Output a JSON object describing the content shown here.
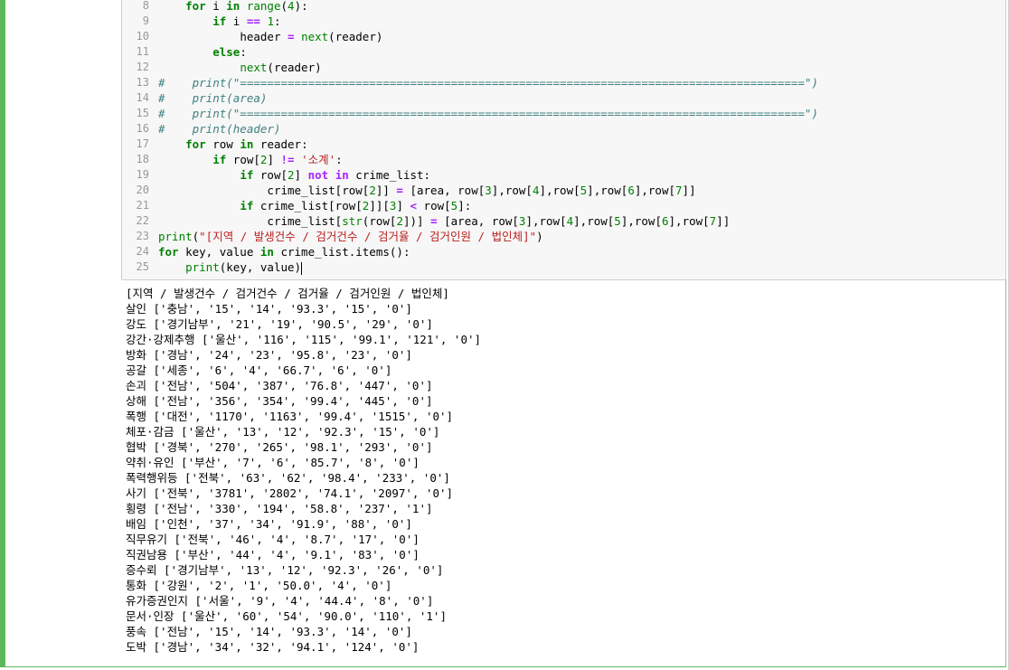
{
  "code_lines": [
    {
      "n": "8",
      "indent": "    ",
      "tokens": [
        [
          "kw",
          "for"
        ],
        [
          "t",
          " i "
        ],
        [
          "kw",
          "in"
        ],
        [
          "t",
          " "
        ],
        [
          "bi",
          "range"
        ],
        [
          "t",
          "("
        ],
        [
          "num",
          "4"
        ],
        [
          "t",
          "):"
        ]
      ]
    },
    {
      "n": "9",
      "indent": "        ",
      "tokens": [
        [
          "kw",
          "if"
        ],
        [
          "t",
          " i "
        ],
        [
          "op",
          "=="
        ],
        [
          "t",
          " "
        ],
        [
          "num",
          "1"
        ],
        [
          "t",
          ":"
        ]
      ]
    },
    {
      "n": "10",
      "indent": "            ",
      "tokens": [
        [
          "t",
          "header "
        ],
        [
          "op",
          "="
        ],
        [
          "t",
          " "
        ],
        [
          "bi",
          "next"
        ],
        [
          "t",
          "(reader)"
        ]
      ]
    },
    {
      "n": "11",
      "indent": "        ",
      "tokens": [
        [
          "kw",
          "else"
        ],
        [
          "t",
          ":"
        ]
      ]
    },
    {
      "n": "12",
      "indent": "            ",
      "tokens": [
        [
          "bi",
          "next"
        ],
        [
          "t",
          "(reader)"
        ]
      ]
    },
    {
      "n": "13",
      "indent": "",
      "tokens": [
        [
          "cm",
          "#    print(\"===================================================================================\")"
        ]
      ]
    },
    {
      "n": "14",
      "indent": "",
      "tokens": [
        [
          "cm",
          "#    print(area)"
        ]
      ]
    },
    {
      "n": "15",
      "indent": "",
      "tokens": [
        [
          "cm",
          "#    print(\"===================================================================================\")"
        ]
      ]
    },
    {
      "n": "16",
      "indent": "",
      "tokens": [
        [
          "cm",
          "#    print(header)"
        ]
      ]
    },
    {
      "n": "17",
      "indent": "    ",
      "tokens": [
        [
          "kw",
          "for"
        ],
        [
          "t",
          " row "
        ],
        [
          "kw",
          "in"
        ],
        [
          "t",
          " reader:"
        ]
      ]
    },
    {
      "n": "18",
      "indent": "        ",
      "tokens": [
        [
          "kw",
          "if"
        ],
        [
          "t",
          " row["
        ],
        [
          "num",
          "2"
        ],
        [
          "t",
          "] "
        ],
        [
          "op",
          "!="
        ],
        [
          "t",
          " "
        ],
        [
          "str",
          "'소계'"
        ],
        [
          "t",
          ":"
        ]
      ]
    },
    {
      "n": "19",
      "indent": "            ",
      "tokens": [
        [
          "kw",
          "if"
        ],
        [
          "t",
          " row["
        ],
        [
          "num",
          "2"
        ],
        [
          "t",
          "] "
        ],
        [
          "op",
          "not in"
        ],
        [
          "t",
          " crime_list:"
        ]
      ]
    },
    {
      "n": "20",
      "indent": "                ",
      "tokens": [
        [
          "t",
          "crime_list[row["
        ],
        [
          "num",
          "2"
        ],
        [
          "t",
          "]] "
        ],
        [
          "op",
          "="
        ],
        [
          "t",
          " [area, row["
        ],
        [
          "num",
          "3"
        ],
        [
          "t",
          "],row["
        ],
        [
          "num",
          "4"
        ],
        [
          "t",
          "],row["
        ],
        [
          "num",
          "5"
        ],
        [
          "t",
          "],row["
        ],
        [
          "num",
          "6"
        ],
        [
          "t",
          "],row["
        ],
        [
          "num",
          "7"
        ],
        [
          "t",
          "]]"
        ]
      ]
    },
    {
      "n": "21",
      "indent": "            ",
      "tokens": [
        [
          "kw",
          "if"
        ],
        [
          "t",
          " crime_list[row["
        ],
        [
          "num",
          "2"
        ],
        [
          "t",
          "]]["
        ],
        [
          "num",
          "3"
        ],
        [
          "t",
          "] "
        ],
        [
          "op",
          "<"
        ],
        [
          "t",
          " row["
        ],
        [
          "num",
          "5"
        ],
        [
          "t",
          "]:"
        ]
      ]
    },
    {
      "n": "22",
      "indent": "                ",
      "tokens": [
        [
          "t",
          "crime_list["
        ],
        [
          "bi",
          "str"
        ],
        [
          "t",
          "(row["
        ],
        [
          "num",
          "2"
        ],
        [
          "t",
          "])] "
        ],
        [
          "op",
          "="
        ],
        [
          "t",
          " [area, row["
        ],
        [
          "num",
          "3"
        ],
        [
          "t",
          "],row["
        ],
        [
          "num",
          "4"
        ],
        [
          "t",
          "],row["
        ],
        [
          "num",
          "5"
        ],
        [
          "t",
          "],row["
        ],
        [
          "num",
          "6"
        ],
        [
          "t",
          "],row["
        ],
        [
          "num",
          "7"
        ],
        [
          "t",
          "]]"
        ]
      ]
    },
    {
      "n": "23",
      "indent": "",
      "tokens": [
        [
          "bi",
          "print"
        ],
        [
          "t",
          "("
        ],
        [
          "str",
          "\"[지역 / 발생건수 / 검거건수 / 검거율 / 검거인원 / 법인체]\""
        ],
        [
          "t",
          ")"
        ]
      ]
    },
    {
      "n": "24",
      "indent": "",
      "tokens": [
        [
          "kw",
          "for"
        ],
        [
          "t",
          " key, value "
        ],
        [
          "kw",
          "in"
        ],
        [
          "t",
          " crime_list.items():"
        ]
      ]
    },
    {
      "n": "25",
      "indent": "    ",
      "tokens": [
        [
          "bi",
          "print"
        ],
        [
          "t",
          "(key, value)"
        ],
        [
          "cursor",
          ""
        ]
      ]
    }
  ],
  "output_lines": [
    "[지역 / 발생건수 / 검거건수 / 검거율 / 검거인원 / 법인체]",
    "살인 ['충남', '15', '14', '93.3', '15', '0']",
    "강도 ['경기남부', '21', '19', '90.5', '29', '0']",
    "강간·강제추행 ['울산', '116', '115', '99.1', '121', '0']",
    "방화 ['경남', '24', '23', '95.8', '23', '0']",
    "공갈 ['세종', '6', '4', '66.7', '6', '0']",
    "손괴 ['전남', '504', '387', '76.8', '447', '0']",
    "상해 ['전남', '356', '354', '99.4', '445', '0']",
    "폭행 ['대전', '1170', '1163', '99.4', '1515', '0']",
    "체포·감금 ['울산', '13', '12', '92.3', '15', '0']",
    "협박 ['경북', '270', '265', '98.1', '293', '0']",
    "약취·유인 ['부산', '7', '6', '85.7', '8', '0']",
    "폭력행위등 ['전북', '63', '62', '98.4', '233', '0']",
    "사기 ['전북', '3781', '2802', '74.1', '2097', '0']",
    "횡령 ['전남', '330', '194', '58.8', '237', '1']",
    "배임 ['인천', '37', '34', '91.9', '88', '0']",
    "직무유기 ['전북', '46', '4', '8.7', '17', '0']",
    "직권남용 ['부산', '44', '4', '9.1', '83', '0']",
    "증수뢰 ['경기남부', '13', '12', '92.3', '26', '0']",
    "통화 ['강원', '2', '1', '50.0', '4', '0']",
    "유가증권인지 ['서울', '9', '4', '44.4', '8', '0']",
    "문서·인장 ['울산', '60', '54', '90.0', '110', '1']",
    "풍속 ['전남', '15', '14', '93.3', '14', '0']",
    "도박 ['경남', '34', '32', '94.1', '124', '0']"
  ]
}
